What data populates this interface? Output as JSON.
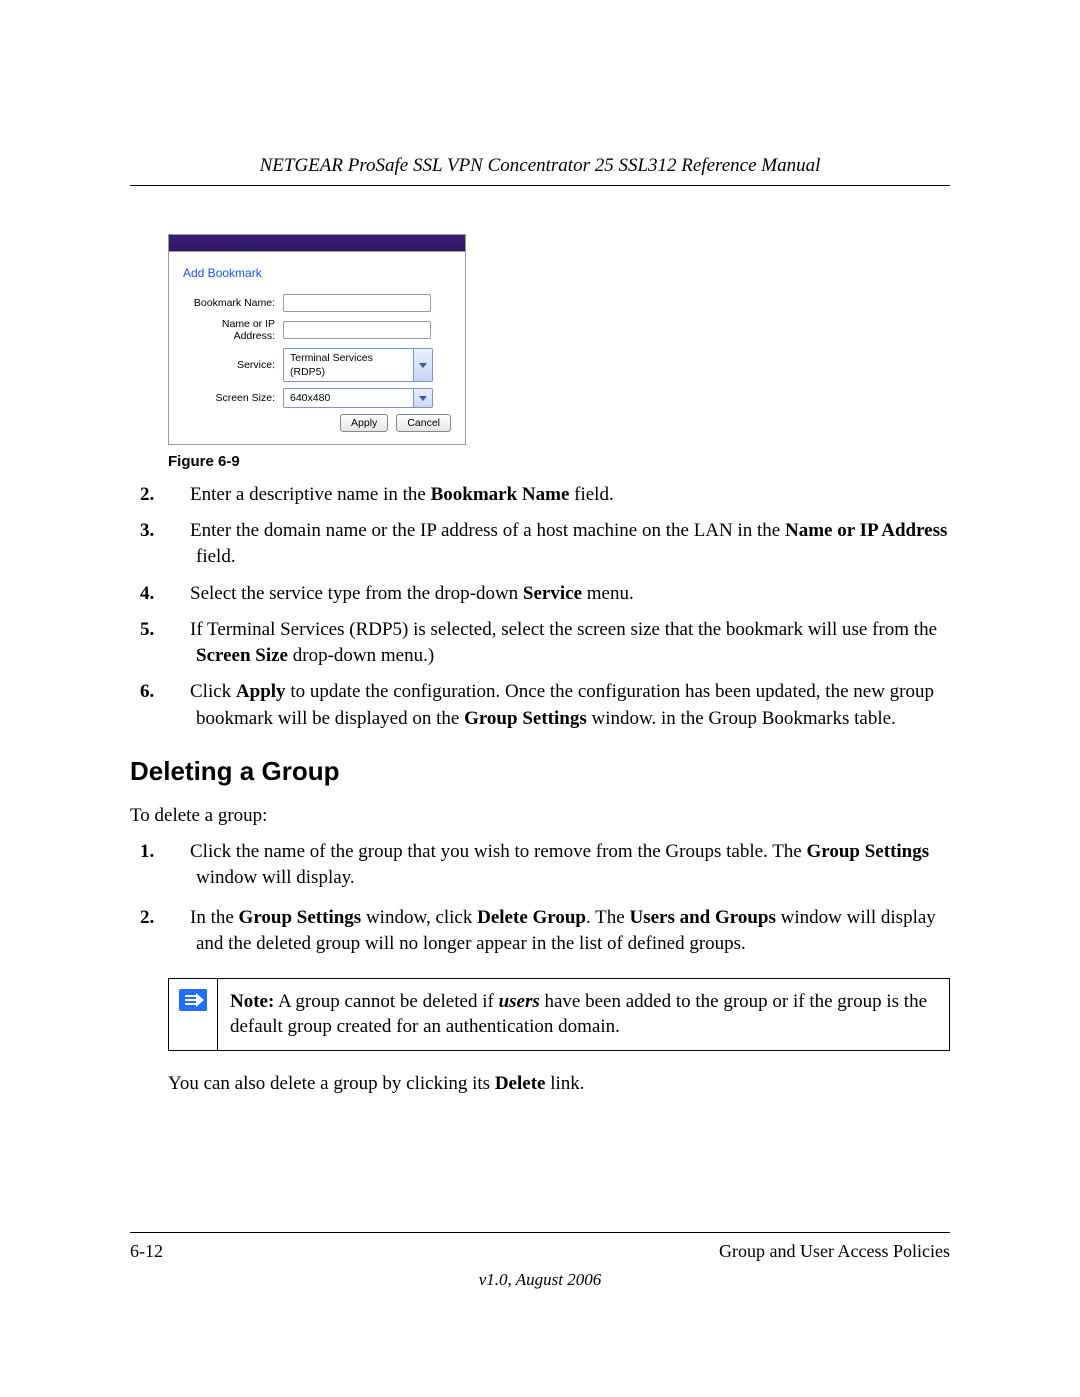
{
  "doc": {
    "header_title": "NETGEAR ProSafe SSL VPN Concentrator 25 SSL312 Reference Manual",
    "page_number": "6-12",
    "footer_right": "Group and User Access Policies",
    "version": "v1.0, August 2006"
  },
  "panel": {
    "title": "Add Bookmark",
    "labels": {
      "bookmark_name": "Bookmark Name:",
      "name_or_ip": "Name or IP Address:",
      "service": "Service:",
      "screen_size": "Screen Size:"
    },
    "values": {
      "bookmark_name": "",
      "name_or_ip": "",
      "service": "Terminal Services (RDP5)",
      "screen_size": "640x480"
    },
    "buttons": {
      "apply": "Apply",
      "cancel": "Cancel"
    }
  },
  "figure_caption": "Figure 6-9",
  "steps_top": [
    {
      "n": "2.",
      "parts": [
        "Enter a descriptive name in the ",
        {
          "b": "Bookmark Name"
        },
        " field."
      ]
    },
    {
      "n": "3.",
      "parts": [
        "Enter the domain name or the IP address of a host machine on the LAN in the ",
        {
          "b": "Name or IP Address"
        },
        " field."
      ]
    },
    {
      "n": "4.",
      "parts": [
        "Select the service type from the drop-down ",
        {
          "b": "Service"
        },
        " menu."
      ]
    },
    {
      "n": "5.",
      "parts": [
        "If Terminal Services (RDP5) is selected, select the screen size that the bookmark will use from the ",
        {
          "b": "Screen Size"
        },
        " drop-down menu.)"
      ]
    },
    {
      "n": "6.",
      "parts": [
        "Click ",
        {
          "b": "Apply"
        },
        " to update the configuration. Once the configuration has been updated, the new group bookmark will be displayed on the ",
        {
          "b": "Group Settings"
        },
        " window. in the Group Bookmarks table."
      ]
    }
  ],
  "section_heading": "Deleting a Group",
  "delete_intro": "To delete a group:",
  "steps_delete": [
    {
      "n": "1.",
      "parts": [
        "Click the name of the group that you wish to remove from the Groups table. The ",
        {
          "b": "Group Settings"
        },
        " window will display."
      ]
    },
    {
      "n": "2.",
      "parts": [
        "In the ",
        {
          "b": "Group Settings"
        },
        " window, click ",
        {
          "b": "Delete Group"
        },
        ". The ",
        {
          "b": "Users and Groups"
        },
        " window will display and the deleted group will no longer appear in the list of defined groups."
      ]
    }
  ],
  "note": {
    "parts": [
      {
        "b": "Note:"
      },
      " A group cannot be deleted if ",
      {
        "bi": "users"
      },
      " have been added to the group or if the group is the default group created for an authentication domain."
    ]
  },
  "after_note": {
    "parts": [
      "You can also delete a group by clicking its ",
      {
        "b": "Delete"
      },
      " link."
    ]
  }
}
